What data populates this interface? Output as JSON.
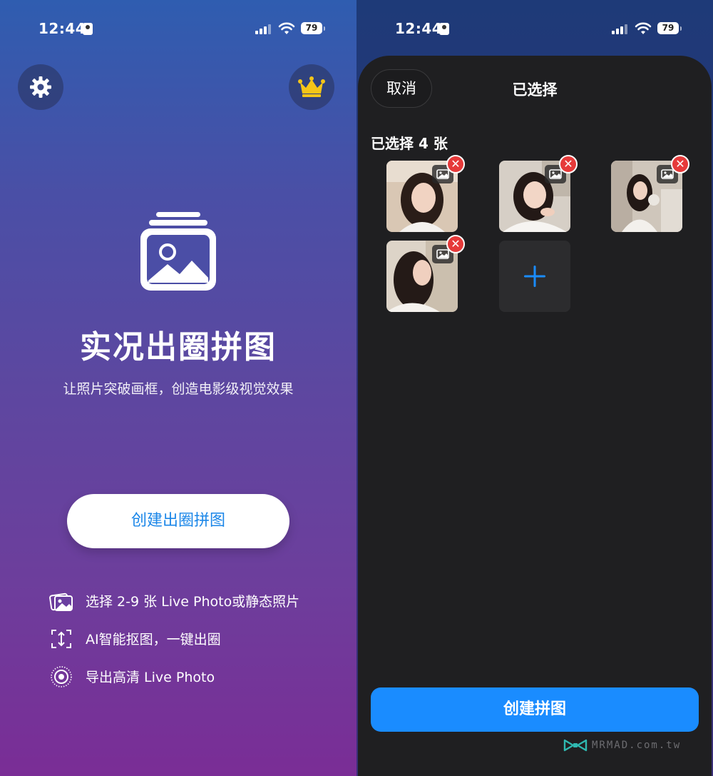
{
  "left": {
    "status": {
      "time": "12:44",
      "battery": "79"
    },
    "app_title": "实况出圈拼图",
    "subtitle": "让照片突破画框，创造电影级视觉效果",
    "create_button": "创建出圈拼图",
    "features": [
      {
        "icon": "photos-icon",
        "text": "选择 2-9 张 Live Photo或静态照片"
      },
      {
        "icon": "crop-cutout-icon",
        "text": "AI智能抠图，一键出圈"
      },
      {
        "icon": "live-photo-icon",
        "text": "导出高清 Live Photo"
      }
    ],
    "colors": {
      "accent": "#1a86e8",
      "crown": "#f5c518"
    }
  },
  "right": {
    "status": {
      "time": "12:44",
      "battery": "79"
    },
    "cancel_button": "取消",
    "title": "已选择",
    "selected_count": "已选择 4 张",
    "photos": [
      {
        "name": "photo-1"
      },
      {
        "name": "photo-2"
      },
      {
        "name": "photo-3"
      },
      {
        "name": "photo-4"
      }
    ],
    "remove_glyph": "✕",
    "add_glyph": "+",
    "create_button": "创建拼图",
    "colors": {
      "primary": "#1a8cff",
      "remove": "#e63a3a"
    }
  },
  "watermark": "MRMAD.com.tw"
}
